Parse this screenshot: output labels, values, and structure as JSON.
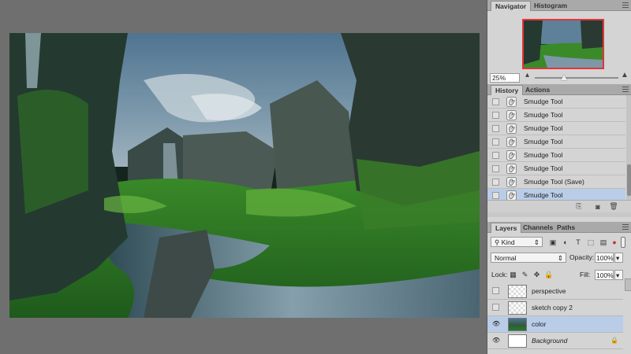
{
  "navigator_panel": {
    "tabs": [
      "Navigator",
      "Histogram"
    ],
    "zoom_value": "25%",
    "zoom_level": 0.35
  },
  "history_panel": {
    "tabs": [
      "History",
      "Actions"
    ],
    "items": [
      {
        "label": "Smudge Tool",
        "selected": false
      },
      {
        "label": "Smudge Tool",
        "selected": false
      },
      {
        "label": "Smudge Tool",
        "selected": false
      },
      {
        "label": "Smudge Tool",
        "selected": false
      },
      {
        "label": "Smudge Tool",
        "selected": false
      },
      {
        "label": "Smudge Tool",
        "selected": false
      },
      {
        "label": "Smudge Tool (Save)",
        "selected": false
      },
      {
        "label": "Smudge Tool",
        "selected": true
      }
    ]
  },
  "layers_panel": {
    "tabs": [
      "Layers",
      "Channels",
      "Paths"
    ],
    "filter_kind": "Kind",
    "blend_mode": "Normal",
    "opacity_label": "Opacity:",
    "opacity_value": "100%",
    "lock_label": "Lock:",
    "fill_label": "Fill:",
    "fill_value": "100%",
    "layers": [
      {
        "name": "perspective",
        "visible": false,
        "selected": false,
        "italic": false
      },
      {
        "name": "sketch copy 2",
        "visible": false,
        "selected": false,
        "italic": false
      },
      {
        "name": "color",
        "visible": true,
        "selected": true,
        "italic": false
      },
      {
        "name": "Background",
        "visible": true,
        "selected": false,
        "italic": true
      }
    ]
  },
  "colors": {
    "selection_highlight": "#b9cde8",
    "navigator_view_box": "#e2353a",
    "panel_bg": "#d4d4d4",
    "workspace_bg": "#6f6f6f"
  }
}
